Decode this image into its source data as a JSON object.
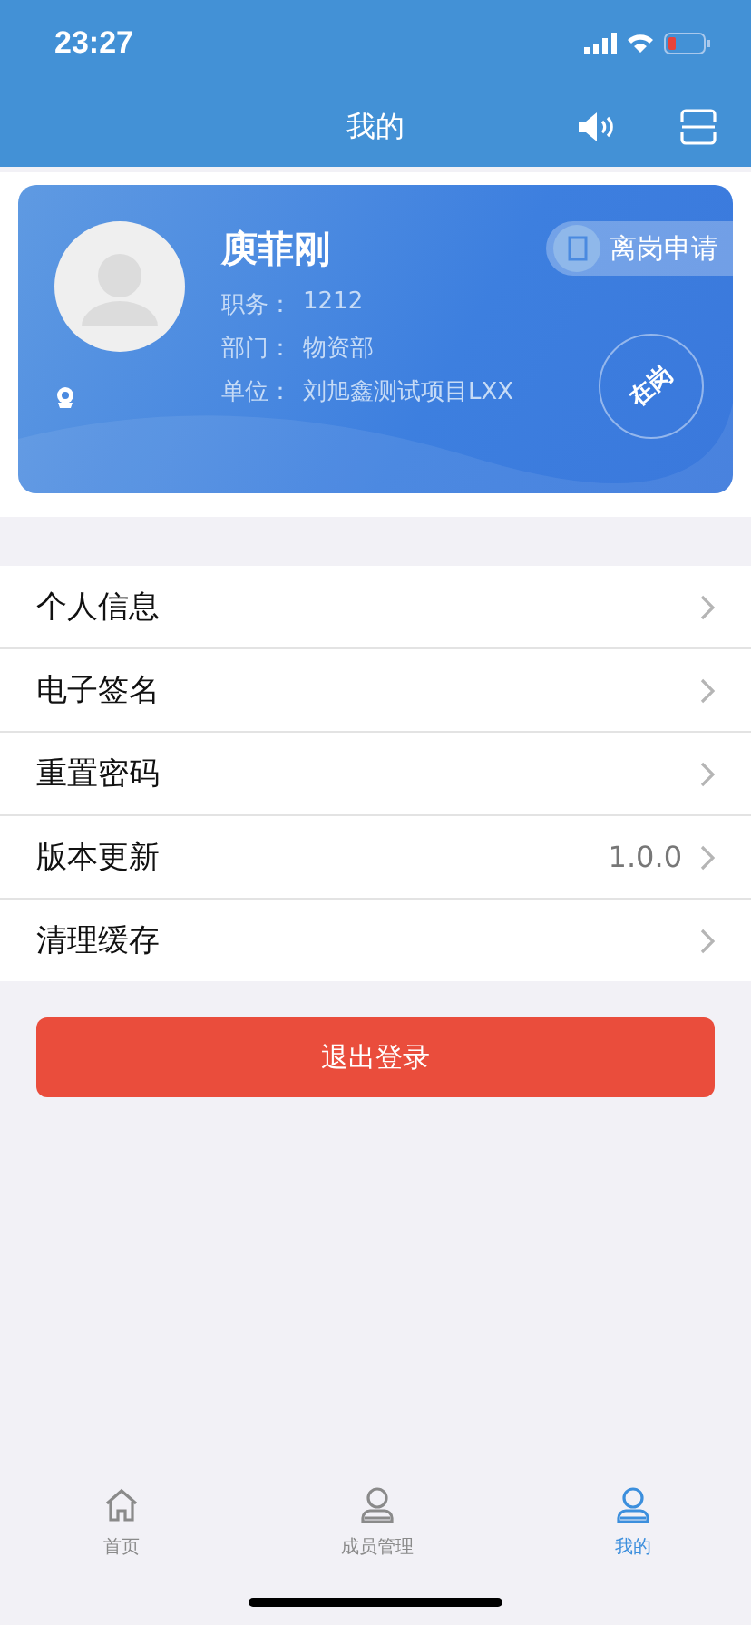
{
  "status_bar": {
    "time": "23:27"
  },
  "header": {
    "title": "我的"
  },
  "profile": {
    "name": "庾菲刚",
    "leave_button": "离岗申请",
    "status_stamp": "在岗",
    "fields": [
      {
        "label": "职务：",
        "value": "1212"
      },
      {
        "label": "部门：",
        "value": "物资部"
      },
      {
        "label": "单位：",
        "value": "刘旭鑫测试项目LXX"
      }
    ]
  },
  "menu": [
    {
      "label": "个人信息"
    },
    {
      "label": "电子签名"
    },
    {
      "label": "重置密码"
    },
    {
      "label": "版本更新",
      "value": "1.0.0"
    },
    {
      "label": "清理缓存"
    }
  ],
  "logout_button": "退出登录",
  "tab_bar": [
    {
      "label": "首页",
      "kind": "home",
      "selected": false
    },
    {
      "label": "成员管理",
      "kind": "person",
      "selected": false
    },
    {
      "label": "我的",
      "kind": "person",
      "selected": true
    }
  ]
}
